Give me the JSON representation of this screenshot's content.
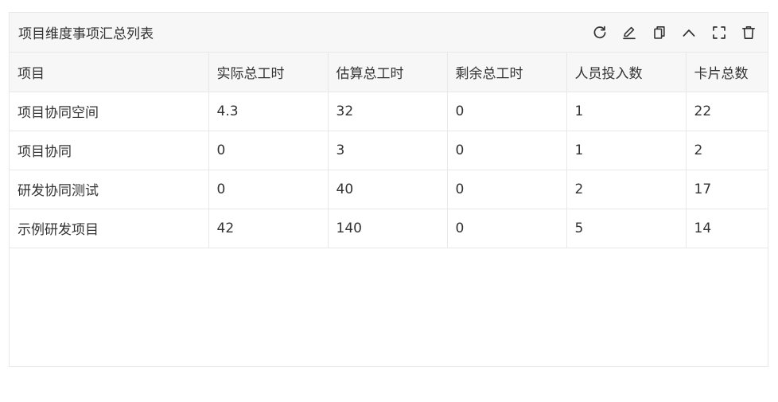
{
  "panel": {
    "title": "项目维度事项汇总列表",
    "toolbar": [
      {
        "name": "refresh-icon"
      },
      {
        "name": "edit-icon"
      },
      {
        "name": "copy-icon"
      },
      {
        "name": "collapse-icon"
      },
      {
        "name": "fullscreen-icon"
      },
      {
        "name": "delete-icon"
      }
    ]
  },
  "table": {
    "columns": [
      "项目",
      "实际总工时",
      "估算总工时",
      "剩余总工时",
      "人员投入数",
      "卡片总数"
    ],
    "rows": [
      [
        "项目协同空间",
        "4.3",
        "32",
        "0",
        "1",
        "22"
      ],
      [
        "项目协同",
        "0",
        "3",
        "0",
        "1",
        "2"
      ],
      [
        "研发协同测试",
        "0",
        "40",
        "0",
        "2",
        "17"
      ],
      [
        "示例研发项目",
        "42",
        "140",
        "0",
        "5",
        "14"
      ]
    ]
  },
  "colors": {
    "header_bg": "#f7f7f7",
    "border": "#e8e8e8",
    "text": "#333333"
  }
}
